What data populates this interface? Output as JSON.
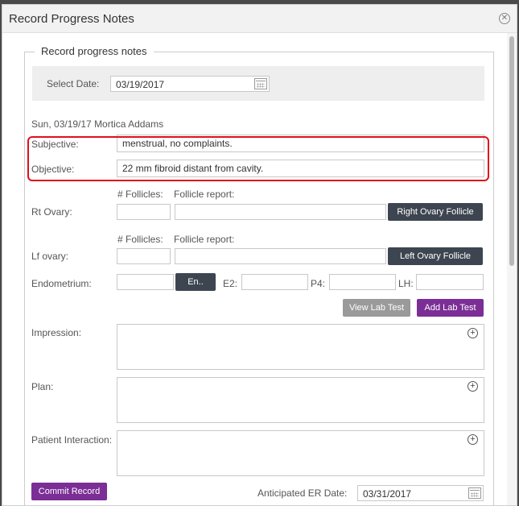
{
  "dialog": {
    "title": "Record Progress Notes",
    "close_icon": "close-circle-icon"
  },
  "section": {
    "legend": "Record progress notes"
  },
  "select_date": {
    "label": "Select Date:",
    "value": "03/19/2017",
    "icon": "calendar-icon"
  },
  "patient_line": "Sun, 03/19/17 Mortica Addams",
  "subjective": {
    "label": "Subjective:",
    "value": "menstrual, no complaints."
  },
  "objective": {
    "label": "Objective:",
    "value": "22 mm fibroid distant from cavity."
  },
  "rt_ovary": {
    "label": "Rt Ovary:",
    "follicles_label": "# Follicles:",
    "report_label": "Follicle report:",
    "button": "Right Ovary Follicle"
  },
  "lf_ovary": {
    "label": "Lf ovary:",
    "follicles_label": "# Follicles:",
    "report_label": "Follicle report:",
    "button": "Left Ovary Follicle"
  },
  "endometrium": {
    "label": "Endometrium:",
    "button": "En..",
    "e2_label": "E2:",
    "p4_label": "P4:",
    "lh_label": "LH:"
  },
  "lab_buttons": {
    "view": "View Lab Test",
    "add": "Add Lab Test"
  },
  "impression": {
    "label": "Impression:"
  },
  "plan": {
    "label": "Plan:"
  },
  "patient_interaction": {
    "label": "Patient Interaction:"
  },
  "footer": {
    "commit": "Commit Record",
    "anticipated_label": "Anticipated ER Date:",
    "anticipated_value": "03/31/2017"
  },
  "colors": {
    "highlight": "#e0101b",
    "dark_button": "#3d4550",
    "purple_button": "#7b2e95",
    "grey_button": "#9a9a9a"
  }
}
